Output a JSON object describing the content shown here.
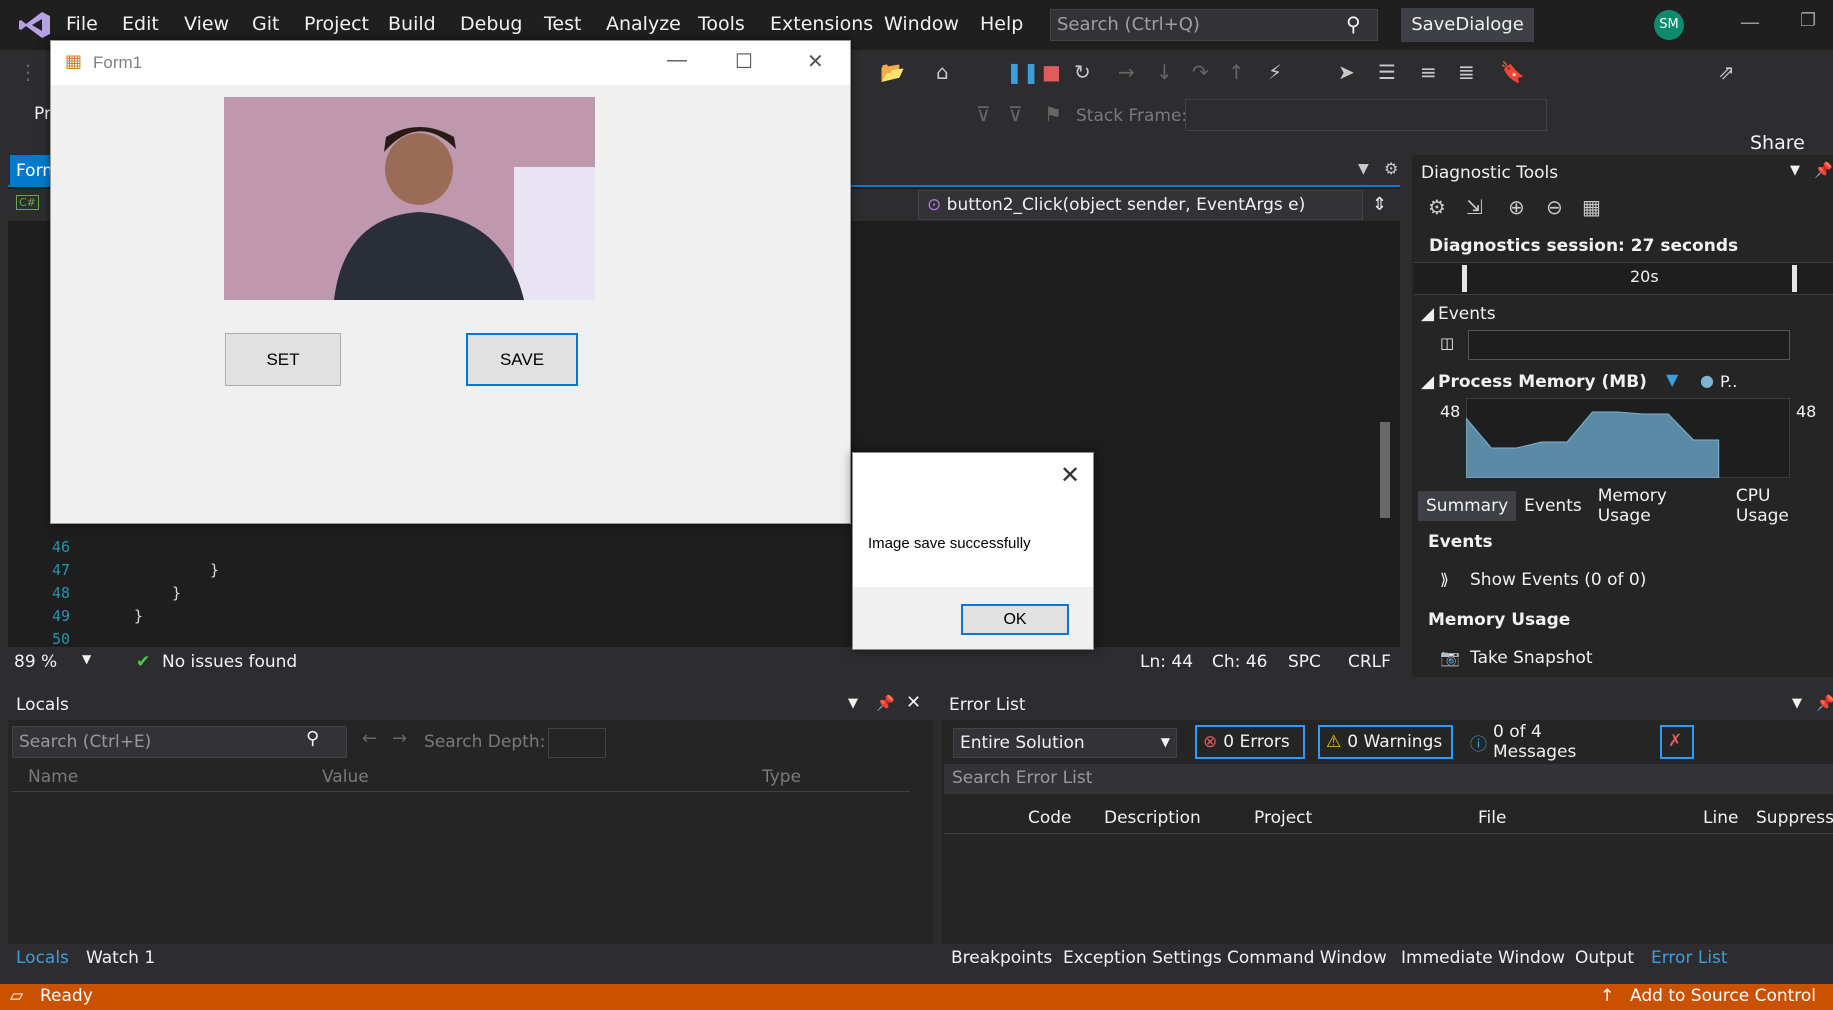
{
  "menubar": {
    "items": [
      "File",
      "Edit",
      "View",
      "Git",
      "Project",
      "Build",
      "Debug",
      "Test",
      "Analyze",
      "Tools",
      "Extensions",
      "Window",
      "Help"
    ],
    "search_placeholder": "Search (Ctrl+Q)",
    "solution_name": "SaveDialoge",
    "avatar_initials": "SM"
  },
  "toolbar": {
    "live_share": "Live Share",
    "stack_frame_label": "Stack Frame:",
    "project_fragment": "Pr"
  },
  "editor": {
    "tab_label": "Form",
    "lang_badge": "C#",
    "method_dropdown": "button2_Click(object sender, EventArgs e)",
    "lines": [
      {
        "num": "46",
        "code": ""
      },
      {
        "num": "47",
        "code": "}"
      },
      {
        "num": "48",
        "code": "}"
      },
      {
        "num": "49",
        "code": "}"
      },
      {
        "num": "50",
        "code": ""
      }
    ],
    "status": {
      "zoom": "89 %",
      "issues": "No issues found",
      "ln": "Ln: 44",
      "ch": "Ch: 46",
      "spc": "SPC",
      "crlf": "CRLF"
    }
  },
  "diagnostics": {
    "title": "Diagnostic Tools",
    "session": "Diagnostics session: 27 seconds",
    "timeline_label": "20s",
    "events_section": "Events",
    "process_memory": "Process Memory (MB)",
    "legend_short": "P..",
    "mem_left": "48",
    "mem_right": "48",
    "tabs": [
      "Summary",
      "Events",
      "Memory Usage",
      "CPU Usage"
    ],
    "events_head": "Events",
    "show_events": "Show Events (0 of 0)",
    "memory_usage_head": "Memory Usage",
    "take_snapshot": "Take Snapshot"
  },
  "locals": {
    "title": "Locals",
    "search_placeholder": "Search (Ctrl+E)",
    "search_depth": "Search Depth:",
    "columns": [
      "Name",
      "Value",
      "Type"
    ],
    "tabs": [
      "Locals",
      "Watch 1"
    ]
  },
  "error_list": {
    "title": "Error List",
    "scope": "Entire Solution",
    "errors": "0 Errors",
    "warnings": "0 Warnings",
    "messages": "0 of 4 Messages",
    "search_placeholder": "Search Error List",
    "columns": [
      "Code",
      "Description",
      "Project",
      "File",
      "Line",
      "Suppressi"
    ],
    "bottom_tabs": [
      "Breakpoints",
      "Exception Settings",
      "Command Window",
      "Immediate Window",
      "Output",
      "Error List"
    ]
  },
  "statusbar": {
    "ready": "Ready",
    "source_control": "Add to Source Control"
  },
  "form1": {
    "title": "Form1",
    "set_label": "SET",
    "save_label": "SAVE"
  },
  "messagebox": {
    "text": "Image save successfully",
    "ok_label": "OK"
  },
  "memory_chart": {
    "values": [
      48,
      46.5,
      46.5,
      46.8,
      46.8,
      48.3,
      48.3,
      48.2,
      48.2,
      46.9,
      46.9
    ],
    "color": "#5b8aa6"
  }
}
